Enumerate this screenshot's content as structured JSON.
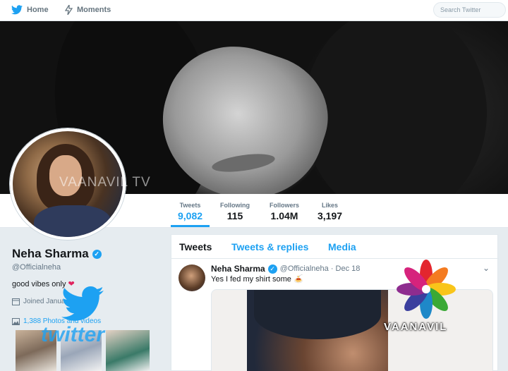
{
  "nav": {
    "home_label": "Home",
    "moments_label": "Moments",
    "search_placeholder": "Search Twitter"
  },
  "stats": [
    {
      "label": "Tweets",
      "value": "9,082"
    },
    {
      "label": "Following",
      "value": "115"
    },
    {
      "label": "Followers",
      "value": "1.04M"
    },
    {
      "label": "Likes",
      "value": "3,197"
    }
  ],
  "profile": {
    "name": "Neha Sharma",
    "handle": "@Officialneha",
    "bio": "good vibes only",
    "bio_emoji": "❤",
    "joined": "Joined January",
    "photos_link": "1,388 Photos and videos"
  },
  "timeline": {
    "tabs": [
      "Tweets",
      "Tweets & replies",
      "Media"
    ],
    "tweet": {
      "name": "Neha Sharma",
      "handle_date": "@Officialneha · Dec 18",
      "text": "Yes I fed my shirt some",
      "emoji": "🍝"
    }
  },
  "overlays": {
    "watermark": "VAANAVIL TV",
    "twitter_wordmark": "twitter",
    "channel_logo": "VAANAVIL"
  },
  "colors": {
    "accent": "#1da1f2",
    "heart": "#e0245e"
  }
}
